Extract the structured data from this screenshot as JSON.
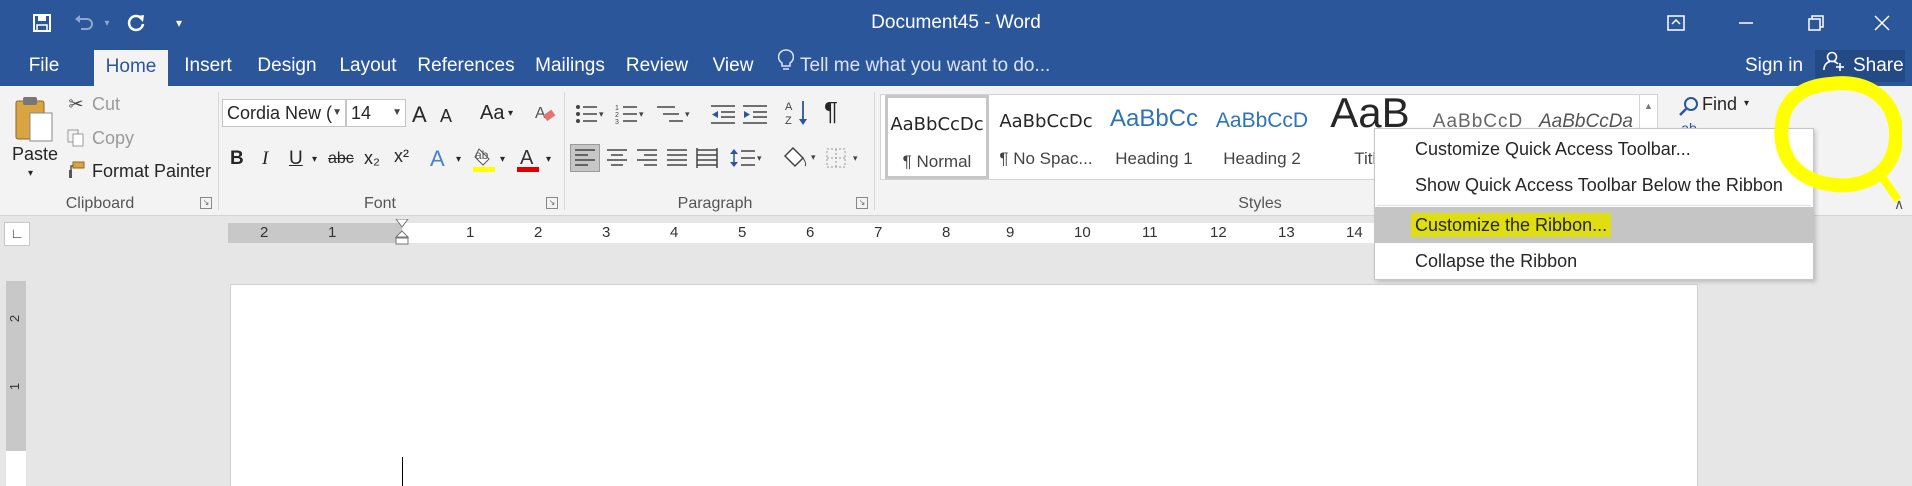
{
  "window": {
    "title": "Document45 - Word",
    "controls": [
      "ribbon-display-options",
      "minimize",
      "restore",
      "close"
    ]
  },
  "qat": {
    "save_icon": "save-icon",
    "undo_icon": "undo-icon",
    "redo_icon": "redo-icon",
    "customize_icon": "customize-qat-icon"
  },
  "tabs": {
    "file": "File",
    "home": "Home",
    "insert": "Insert",
    "design": "Design",
    "layout": "Layout",
    "references": "References",
    "mailings": "Mailings",
    "review": "Review",
    "view": "View",
    "tell_me": "Tell me what you want to do...",
    "sign_in": "Sign in",
    "share": "Share"
  },
  "clipboard": {
    "paste": "Paste",
    "cut": "Cut",
    "copy": "Copy",
    "format_painter": "Format Painter",
    "group_label": "Clipboard"
  },
  "font": {
    "family": "Cordia New (",
    "size": "14",
    "group_label": "Font",
    "case_label": "Aa",
    "bold": "B",
    "italic": "I",
    "underline": "U",
    "strike": "abc",
    "subscript": "x₂",
    "superscript": "x²",
    "grow": "A",
    "shrink": "A"
  },
  "paragraph": {
    "group_label": "Paragraph",
    "pilcrow": "¶"
  },
  "styles": {
    "group_label": "Styles",
    "items": [
      {
        "sample": "AaBbCcDc",
        "name": "¶ Normal"
      },
      {
        "sample": "AaBbCcDc",
        "name": "¶ No Spac..."
      },
      {
        "sample": "AaBbCc",
        "name": "Heading 1"
      },
      {
        "sample": "AaBbCcD",
        "name": "Heading 2"
      },
      {
        "sample": "AaB",
        "name": "Title"
      },
      {
        "sample": "AaBbCcD",
        "name": ""
      },
      {
        "sample": "AaBbCcDa",
        "name": ""
      }
    ]
  },
  "editing": {
    "find": "Find"
  },
  "ruler": {
    "numbers": [
      "2",
      "1",
      "1",
      "2",
      "3",
      "4",
      "5",
      "6",
      "7",
      "8",
      "9",
      "10",
      "11",
      "12",
      "13",
      "14"
    ]
  },
  "vruler": {
    "numbers": [
      "2",
      "1"
    ]
  },
  "context_menu": {
    "items": [
      {
        "label": "Customize Quick Access Toolbar...",
        "highlighted": false
      },
      {
        "label": "Show Quick Access Toolbar Below the Ribbon",
        "highlighted": false
      },
      {
        "label": "Customize the Ribbon...",
        "highlighted": true
      },
      {
        "label": "Collapse the Ribbon",
        "highlighted": false
      }
    ]
  },
  "colors": {
    "title_bar": "#2b579a",
    "highlight_marker": "#ffff00",
    "hover": "#c5c5c5"
  }
}
